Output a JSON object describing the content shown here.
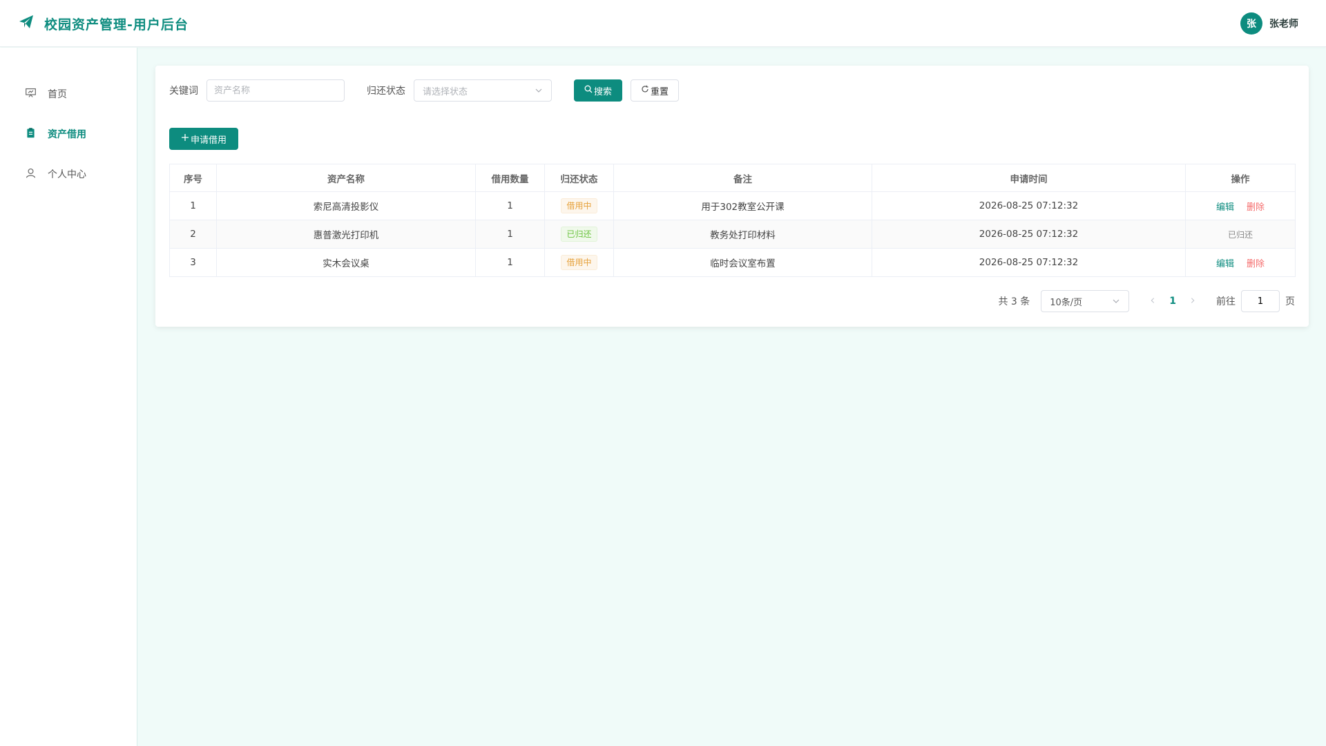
{
  "header": {
    "title": "校园资产管理-用户后台",
    "user_avatar_text": "张",
    "user_name": "张老师",
    "accent": "#0d8c7f"
  },
  "sidebar": {
    "items": [
      {
        "label": "首页",
        "icon": "presentation-icon",
        "active": false
      },
      {
        "label": "资产借用",
        "icon": "clipboard-icon",
        "active": true
      },
      {
        "label": "个人中心",
        "icon": "user-icon",
        "active": false
      }
    ]
  },
  "filters": {
    "keyword_label": "关键词",
    "keyword_placeholder": "资产名称",
    "status_label": "归还状态",
    "status_placeholder": "请选择状态",
    "search_label": "搜索",
    "reset_label": "重置"
  },
  "actions": {
    "add_label": "申请借用"
  },
  "table": {
    "columns": [
      "序号",
      "资产名称",
      "借用数量",
      "归还状态",
      "备注",
      "申请时间",
      "操作"
    ],
    "rows": [
      {
        "no": "1",
        "name": "索尼高清投影仪",
        "qty": "1",
        "status": "借用中",
        "status_type": "warning",
        "note": "用于302教室公开课",
        "time": "2026-08-25 07:12:32",
        "ops": [
          "编辑",
          "删除"
        ]
      },
      {
        "no": "2",
        "name": "惠普激光打印机",
        "qty": "1",
        "status": "已归还",
        "status_type": "success",
        "note": "教务处打印材料",
        "time": "2026-08-25 07:12:32",
        "ops_text": "已归还"
      },
      {
        "no": "3",
        "name": "实木会议桌",
        "qty": "1",
        "status": "借用中",
        "status_type": "warning",
        "note": "临时会议室布置",
        "time": "2026-08-25 07:12:32",
        "ops": [
          "编辑",
          "删除"
        ]
      }
    ]
  },
  "pagination": {
    "total_text": "共 3 条",
    "page_size": "10条/页",
    "current_page": "1",
    "goto_label": "前往",
    "goto_value": "1",
    "page_suffix": "页"
  }
}
